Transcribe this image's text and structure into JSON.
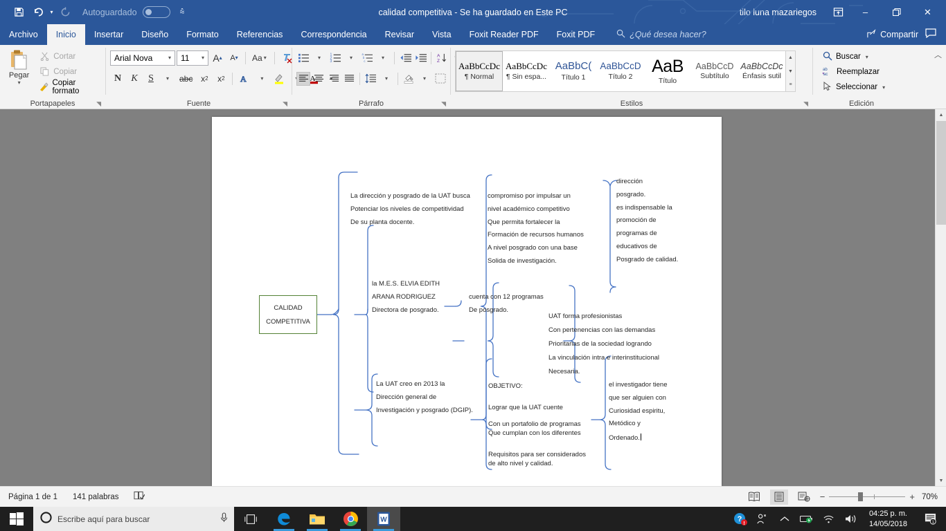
{
  "titlebar": {
    "autosave_label": "Autoguardado",
    "doc_title": "calidad competitiva  -  Se ha guardado en Este PC",
    "account_name": "tilo luna mazariegos",
    "save_icon": "save-icon",
    "undo_icon": "undo-icon",
    "redo_icon": "redo-icon",
    "customize_icon": "customize-quick-access-icon",
    "ribbon_display_icon": "ribbon-display-options-icon",
    "minimize_label": "–",
    "restore_label": "❐",
    "close_label": "✕"
  },
  "tabs": [
    {
      "label": "Archivo",
      "active": false
    },
    {
      "label": "Inicio",
      "active": true
    },
    {
      "label": "Insertar",
      "active": false
    },
    {
      "label": "Diseño",
      "active": false
    },
    {
      "label": "Formato",
      "active": false
    },
    {
      "label": "Referencias",
      "active": false
    },
    {
      "label": "Correspondencia",
      "active": false
    },
    {
      "label": "Revisar",
      "active": false
    },
    {
      "label": "Vista",
      "active": false
    },
    {
      "label": "Foxit Reader PDF",
      "active": false
    },
    {
      "label": "Foxit PDF",
      "active": false
    }
  ],
  "tellme": {
    "placeholder": "¿Qué desea hacer?",
    "icon": "search-icon"
  },
  "share": {
    "label": "Compartir",
    "icon": "share-icon",
    "comments_icon": "comments-icon"
  },
  "ribbon": {
    "clipboard": {
      "group_label": "Portapapeles",
      "paste_label": "Pegar",
      "cut_label": "Cortar",
      "copy_label": "Copiar",
      "format_painter_label": "Copiar formato"
    },
    "font": {
      "group_label": "Fuente",
      "font_family": "Arial Nova",
      "font_size": "11",
      "grow_label": "A",
      "shrink_label": "A",
      "change_case_label": "Aa",
      "clear_format_label": "clear-formatting",
      "bold_label": "N",
      "italic_label": "K",
      "underline_label": "S",
      "strike_label": "abc",
      "subscript_label": "x",
      "superscript_label": "x",
      "text_effects_label": "A",
      "highlight_label": "ab",
      "font_color_label": "A"
    },
    "paragraph": {
      "group_label": "Párrafo",
      "bullets": "bullets-icon",
      "numbering": "numbering-icon",
      "multilevel": "multilevel-list-icon",
      "decrease_indent": "decrease-indent-icon",
      "increase_indent": "increase-indent-icon",
      "sort": "sort-icon",
      "show_marks": "¶",
      "align_left": "align-left-icon",
      "align_center": "align-center-icon",
      "align_right": "align-right-icon",
      "justify": "justify-icon",
      "line_spacing": "line-spacing-icon",
      "shading": "shading-icon",
      "borders": "borders-icon"
    },
    "styles": {
      "group_label": "Estilos",
      "items": [
        {
          "preview": "AaBbCcDc",
          "name": "¶ Normal",
          "selected": true
        },
        {
          "preview": "AaBbCcDc",
          "name": "¶ Sin espa...",
          "selected": false
        },
        {
          "preview": "AaBbC(",
          "name": "Título 1",
          "selected": false
        },
        {
          "preview": "AaBbCcD",
          "name": "Título 2",
          "selected": false
        },
        {
          "preview": "AaB",
          "name": "Título",
          "selected": false
        },
        {
          "preview": "AaBbCcD",
          "name": "Subtítulo",
          "selected": false
        },
        {
          "preview": "AaBbCcDc",
          "name": "Énfasis sutil",
          "selected": false
        }
      ]
    },
    "editing": {
      "group_label": "Edición",
      "find_label": "Buscar",
      "replace_label": "Reemplazar",
      "select_label": "Seleccionar",
      "find_icon": "search-icon",
      "replace_icon": "replace-icon",
      "select_icon": "cursor-select-icon",
      "collapse_icon": "collapse-ribbon-icon"
    }
  },
  "document": {
    "root": {
      "line1": "CALIDAD",
      "line2": "COMPETITIVA"
    },
    "nodes": [
      {
        "id": "node-direccion-posgrado-busca",
        "lines": [
          "La dirección y posgrado de la UAT busca",
          "Potenciar los niveles de competitividad",
          "De su planta docente."
        ]
      },
      {
        "id": "node-compromiso",
        "lines": [
          "compromiso por impulsar un",
          "nivel académico competitivo",
          "Que permita fortalecer la",
          "Formación de recursos humanos",
          "A nivel posgrado con una base",
          "Solida de investigación."
        ]
      },
      {
        "id": "node-direccion-posgrado",
        "lines": [
          "  dirección",
          "posgrado.",
          "es indispensable la",
          "promoción de",
          "programas de",
          "educativos de",
          "Posgrado de calidad."
        ]
      },
      {
        "id": "node-directora",
        "lines": [
          "la M.E.S. ELVIA EDITH",
          "ARANA RODRIGUEZ",
          "Directora de posgrado."
        ]
      },
      {
        "id": "node-programas",
        "lines": [
          "cuenta con 12 programas",
          "De posgrado."
        ]
      },
      {
        "id": "node-profesionistas",
        "lines": [
          "UAT forma profesionistas",
          "Con pertenencias con las demandas",
          "Prioritarias de la sociedad logrando",
          "La vinculación intra e interinstitucional",
          "Necesaria."
        ]
      },
      {
        "id": "node-dgip",
        "lines": [
          "La UAT creo en 2013 la",
          "Dirección general de",
          "Investigación y posgrado (DGIP)."
        ]
      },
      {
        "id": "node-objetivo",
        "lines": [
          "OBJETIVO:",
          "Lograr que la UAT cuente",
          "Con un portafolio de programas",
          "Que cumplan con los diferentes",
          "Requisitos para ser considerados",
          "de alto nivel y calidad."
        ]
      },
      {
        "id": "node-investigador",
        "lines": [
          "el investigador tiene",
          "que ser alguien con",
          "Curiosidad espiritu,",
          "Metódico y",
          "Ordenado."
        ]
      }
    ]
  },
  "statusbar": {
    "page_label": "Página 1 de 1",
    "words_label": "141 palabras",
    "proofing_icon": "proofing-status-icon",
    "read_mode_icon": "read-mode-icon",
    "print_layout_icon": "print-layout-icon",
    "web_layout_icon": "web-layout-icon",
    "zoom_out_label": "−",
    "zoom_in_label": "+",
    "zoom_level": "70%"
  },
  "taskbar": {
    "start_icon": "windows-start-icon",
    "search_placeholder": "Escribe aquí para buscar",
    "cortana_icon": "cortana-circle-icon",
    "mic_icon": "microphone-icon",
    "task_view_icon": "task-view-icon",
    "apps": [
      {
        "name": "edge-icon",
        "running": true,
        "active": false
      },
      {
        "name": "file-explorer-icon",
        "running": true,
        "active": false
      },
      {
        "name": "chrome-icon",
        "running": true,
        "active": false
      },
      {
        "name": "word-icon",
        "running": true,
        "active": true
      }
    ],
    "tray": [
      {
        "name": "help-alert-icon"
      },
      {
        "name": "people-icon"
      },
      {
        "name": "show-hidden-icons-chevron"
      },
      {
        "name": "battery-icon"
      },
      {
        "name": "wifi-icon"
      },
      {
        "name": "volume-icon"
      }
    ],
    "clock_time": "04:25 p. m.",
    "clock_date": "14/05/2018",
    "notification_icon": "notifications-icon",
    "notification_count": "1"
  },
  "colors": {
    "word_blue": "#2b579a",
    "ribbon_bg": "#f3f3f3",
    "page_bg_gray": "#808080",
    "connector_blue": "#4472c4",
    "root_border_green": "#538135",
    "accent_taskbar": "#3a9bdc"
  }
}
